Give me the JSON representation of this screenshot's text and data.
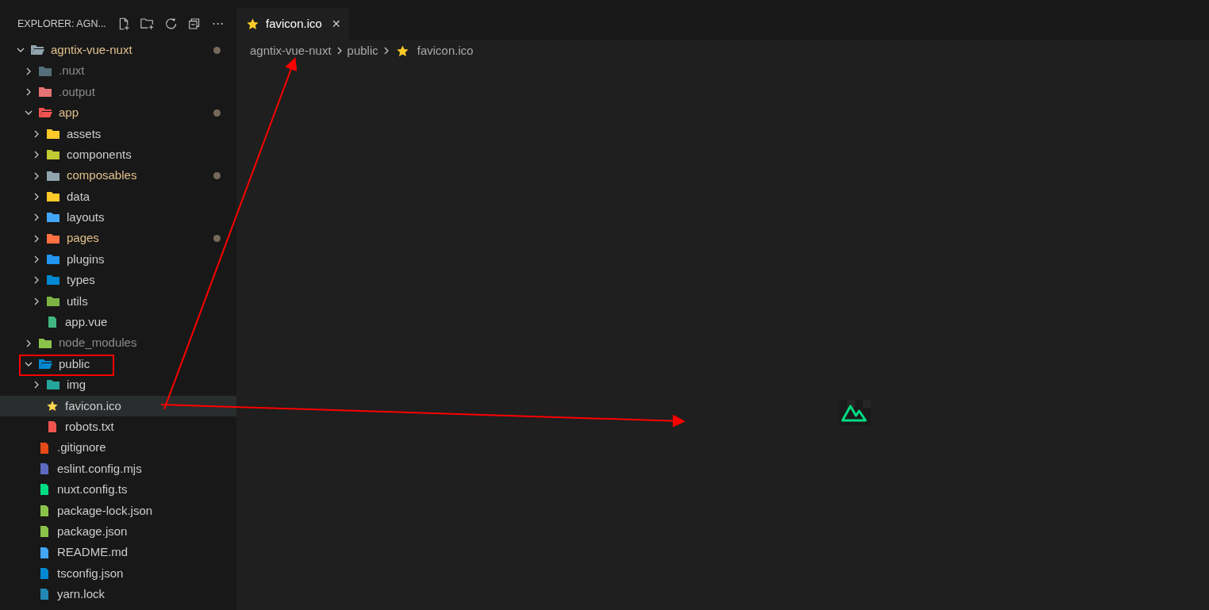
{
  "explorer": {
    "title": "EXPLORER: AGN...",
    "tree": [
      {
        "name": "agntix-vue-nuxt",
        "kind": "folder",
        "expanded": true,
        "modified": true,
        "ignored": false,
        "selected": false,
        "color": "#90a4ae",
        "children": [
          {
            "name": ".nuxt",
            "kind": "folder",
            "expanded": false,
            "modified": false,
            "ignored": true,
            "selected": false,
            "color": "#546e7a"
          },
          {
            "name": ".output",
            "kind": "folder",
            "expanded": false,
            "modified": false,
            "ignored": true,
            "selected": false,
            "color": "#e57373"
          },
          {
            "name": "app",
            "kind": "folder",
            "expanded": true,
            "modified": true,
            "ignored": false,
            "selected": false,
            "color": "#ef5350",
            "children": [
              {
                "name": "assets",
                "kind": "folder",
                "expanded": false,
                "modified": false,
                "ignored": false,
                "selected": false,
                "color": "#ffca28"
              },
              {
                "name": "components",
                "kind": "folder",
                "expanded": false,
                "modified": false,
                "ignored": false,
                "selected": false,
                "color": "#c0ca33"
              },
              {
                "name": "composables",
                "kind": "folder",
                "expanded": false,
                "modified": true,
                "ignored": false,
                "selected": false,
                "color": "#90a4ae"
              },
              {
                "name": "data",
                "kind": "folder",
                "expanded": false,
                "modified": false,
                "ignored": false,
                "selected": false,
                "color": "#ffca28"
              },
              {
                "name": "layouts",
                "kind": "folder",
                "expanded": false,
                "modified": false,
                "ignored": false,
                "selected": false,
                "color": "#42a5f5"
              },
              {
                "name": "pages",
                "kind": "folder",
                "expanded": false,
                "modified": true,
                "ignored": false,
                "selected": false,
                "color": "#ff7043"
              },
              {
                "name": "plugins",
                "kind": "folder",
                "expanded": false,
                "modified": false,
                "ignored": false,
                "selected": false,
                "color": "#2196f3"
              },
              {
                "name": "types",
                "kind": "folder",
                "expanded": false,
                "modified": false,
                "ignored": false,
                "selected": false,
                "color": "#0288d1"
              },
              {
                "name": "utils",
                "kind": "folder",
                "expanded": false,
                "modified": false,
                "ignored": false,
                "selected": false,
                "color": "#7cb342"
              },
              {
                "name": "app.vue",
                "kind": "file",
                "modified": false,
                "ignored": false,
                "selected": false,
                "color": "#41b883"
              }
            ]
          },
          {
            "name": "node_modules",
            "kind": "folder",
            "expanded": false,
            "modified": false,
            "ignored": true,
            "selected": false,
            "color": "#8bc34a"
          },
          {
            "name": "public",
            "kind": "folder",
            "expanded": true,
            "modified": false,
            "ignored": false,
            "selected": false,
            "color": "#0288d1",
            "children": [
              {
                "name": "img",
                "kind": "folder",
                "expanded": false,
                "modified": false,
                "ignored": false,
                "selected": false,
                "color": "#26a69a"
              },
              {
                "name": "favicon.ico",
                "kind": "file",
                "modified": false,
                "ignored": false,
                "selected": true,
                "color": "#ffd54f"
              },
              {
                "name": "robots.txt",
                "kind": "file",
                "modified": false,
                "ignored": false,
                "selected": false,
                "color": "#ef5350"
              }
            ]
          },
          {
            "name": ".gitignore",
            "kind": "file",
            "modified": false,
            "ignored": false,
            "selected": false,
            "color": "#e64a19"
          },
          {
            "name": "eslint.config.mjs",
            "kind": "file",
            "modified": false,
            "ignored": false,
            "selected": false,
            "color": "#5c6bc0"
          },
          {
            "name": "nuxt.config.ts",
            "kind": "file",
            "modified": false,
            "ignored": false,
            "selected": false,
            "color": "#00dc82"
          },
          {
            "name": "package-lock.json",
            "kind": "file",
            "modified": false,
            "ignored": false,
            "selected": false,
            "color": "#8bc34a"
          },
          {
            "name": "package.json",
            "kind": "file",
            "modified": false,
            "ignored": false,
            "selected": false,
            "color": "#8bc34a"
          },
          {
            "name": "README.md",
            "kind": "file",
            "modified": false,
            "ignored": false,
            "selected": false,
            "color": "#42a5f5"
          },
          {
            "name": "tsconfig.json",
            "kind": "file",
            "modified": false,
            "ignored": false,
            "selected": false,
            "color": "#0288d1"
          },
          {
            "name": "yarn.lock",
            "kind": "file",
            "modified": false,
            "ignored": false,
            "selected": false,
            "color": "#2188b6"
          }
        ]
      }
    ]
  },
  "tab": {
    "label": "favicon.ico",
    "close": "✕"
  },
  "breadcrumbs": [
    "agntix-vue-nuxt",
    "public",
    "favicon.ico"
  ]
}
